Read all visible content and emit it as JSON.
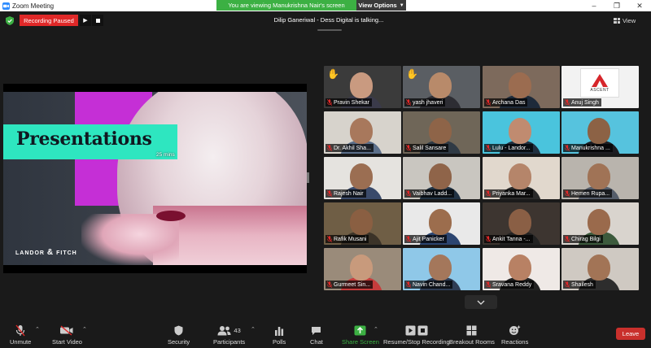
{
  "window": {
    "title": "Zoom Meeting",
    "controls": [
      "minimize",
      "maximize",
      "close"
    ]
  },
  "banner": {
    "message": "You are viewing Manukrishna Nair's screen",
    "options_label": "View Options"
  },
  "recording": {
    "status": "Recording Paused"
  },
  "speaker": {
    "talking_text": "Dilip Ganeriwal - Dess Digital is talking..."
  },
  "view_label": "View",
  "slide": {
    "title": "Presentations",
    "duration": "25 mins",
    "brand_left": "LANDOR",
    "brand_amp": "&",
    "brand_right": "FITCH"
  },
  "participants_grid": [
    {
      "name": "Pravin Shekar",
      "hand": true
    },
    {
      "name": "yash jhaveri",
      "hand": true
    },
    {
      "name": "Archana Das",
      "hand": false
    },
    {
      "name": "Anuj Singh",
      "hand": false,
      "logo_text": "ASCENT"
    },
    {
      "name": "Dr. Akhil Sha...",
      "hand": false
    },
    {
      "name": "Salil Sansare",
      "hand": false
    },
    {
      "name": "Lulu - Landor...",
      "hand": false
    },
    {
      "name": "Manukrishna ...",
      "hand": false
    },
    {
      "name": "Rajesh Nair",
      "hand": false
    },
    {
      "name": "Vaibhav Ladd...",
      "hand": false
    },
    {
      "name": "Priyanka Mar...",
      "hand": false
    },
    {
      "name": "Hemen Rupa...",
      "hand": false
    },
    {
      "name": "Rafik Musani",
      "hand": false
    },
    {
      "name": "Ajit Panicker",
      "hand": false
    },
    {
      "name": "Ankit Tanna -...",
      "hand": false
    },
    {
      "name": "Chirag Bilgi",
      "hand": false
    },
    {
      "name": "Gurmeet Sin...",
      "hand": false
    },
    {
      "name": "Navin Chand...",
      "hand": false
    },
    {
      "name": "Sravana Reddy",
      "hand": false
    },
    {
      "name": "Shailesh",
      "hand": false
    }
  ],
  "toolbar": {
    "unmute": "Unmute",
    "start_video": "Start Video",
    "security": "Security",
    "participants": "Participants",
    "participants_count": "43",
    "polls": "Polls",
    "chat": "Chat",
    "share_screen": "Share Screen",
    "record": "Resume/Stop Recording",
    "breakout": "Breakout Rooms",
    "reactions": "Reactions",
    "leave": "Leave"
  },
  "colors": {
    "recording_red": "#e02828",
    "banner_green": "#3cb043",
    "share_green": "#3cb043",
    "leave_red": "#c9302c",
    "slide_teal": "#2ee6c0",
    "slide_magenta": "#c52fd6"
  }
}
